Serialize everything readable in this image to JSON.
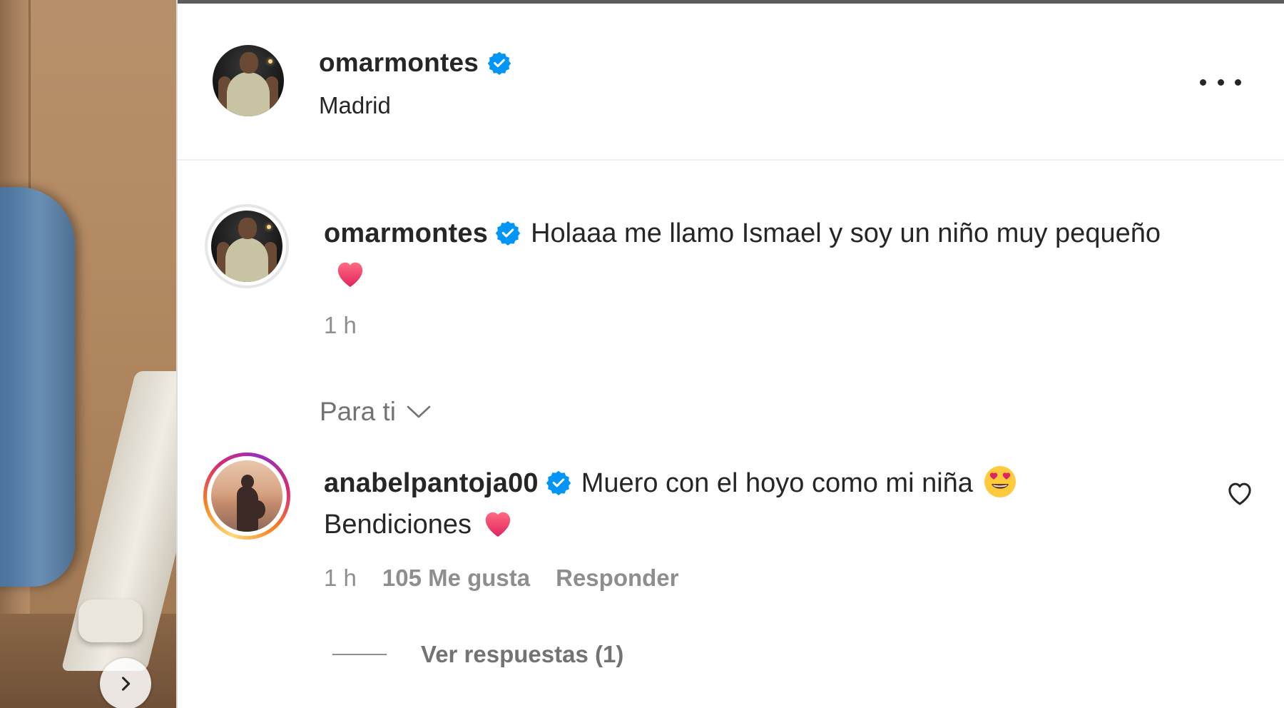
{
  "post": {
    "author": "omarmontes",
    "location": "Madrid",
    "more_icon": "more-horizontal-icon"
  },
  "caption": {
    "username": "omarmontes",
    "text": "Holaaa me llamo Ismael y soy un niño muy pequeño",
    "emoji": "red-heart-icon",
    "time": "1 h"
  },
  "filter": {
    "label": "Para ti",
    "icon": "chevron-down-icon"
  },
  "comments": [
    {
      "username": "anabelpantoja00",
      "text_line1": "Muero con el hoyo como mi niña",
      "emoji1": "heart-eyes-icon",
      "text_line2": "Bendiciones",
      "emoji2": "red-heart-icon",
      "time": "1 h",
      "likes": "105 Me gusta",
      "reply_label": "Responder",
      "view_replies": "Ver respuestas (1)"
    }
  ],
  "colors": {
    "verified_blue": "#0095f6",
    "text_primary": "#262626",
    "text_secondary": "#8e8e8e",
    "heart_red": "#ff3040"
  }
}
